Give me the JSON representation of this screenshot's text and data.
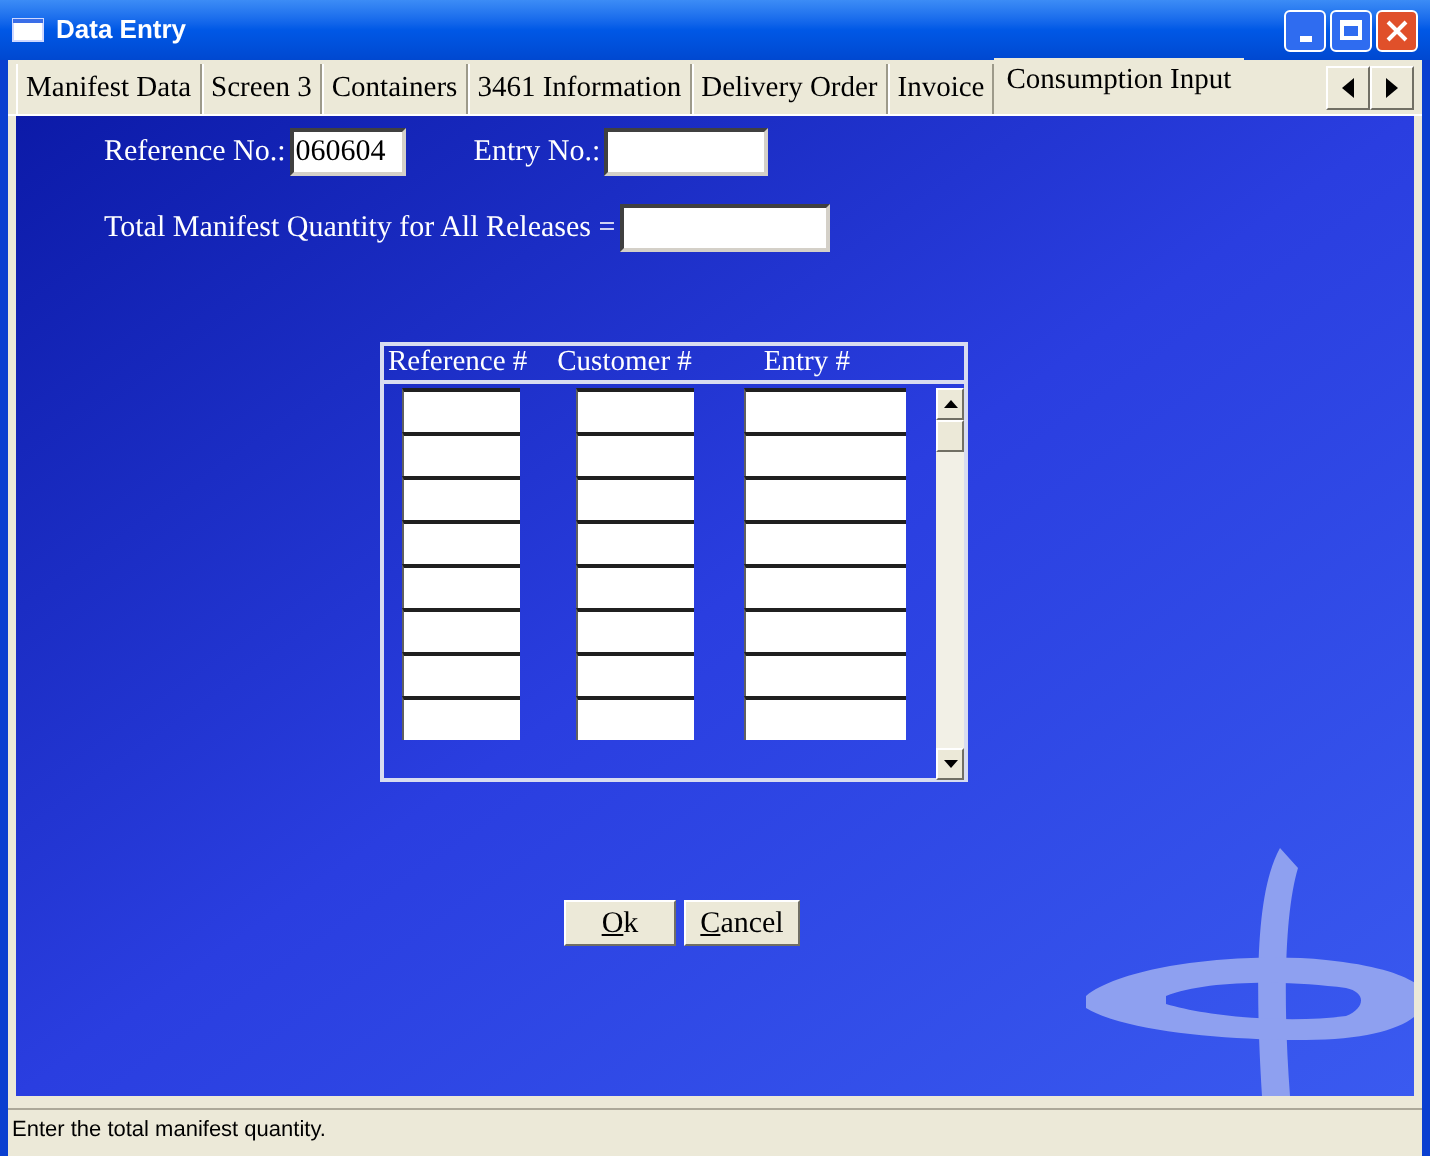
{
  "window": {
    "title": "Data Entry"
  },
  "tabs": [
    {
      "label": "Manifest Data",
      "selected": false
    },
    {
      "label": "Screen 3",
      "selected": false
    },
    {
      "label": "Containers",
      "selected": false
    },
    {
      "label": "3461 Information",
      "selected": false
    },
    {
      "label": "Delivery Order",
      "selected": false
    },
    {
      "label": "Invoice",
      "selected": false
    },
    {
      "label": "Consumption Input",
      "selected": true
    }
  ],
  "form": {
    "reference_label": "Reference No.:",
    "reference_value": "060604",
    "entry_label": "Entry No.:",
    "total_label": "Total Manifest Quantity for All Releases ="
  },
  "grid": {
    "columns": [
      "Reference #",
      "Customer #",
      "Entry #"
    ]
  },
  "buttons": [
    "Ok",
    "Cancel"
  ],
  "status_bar": "Enter the total manifest quantity."
}
